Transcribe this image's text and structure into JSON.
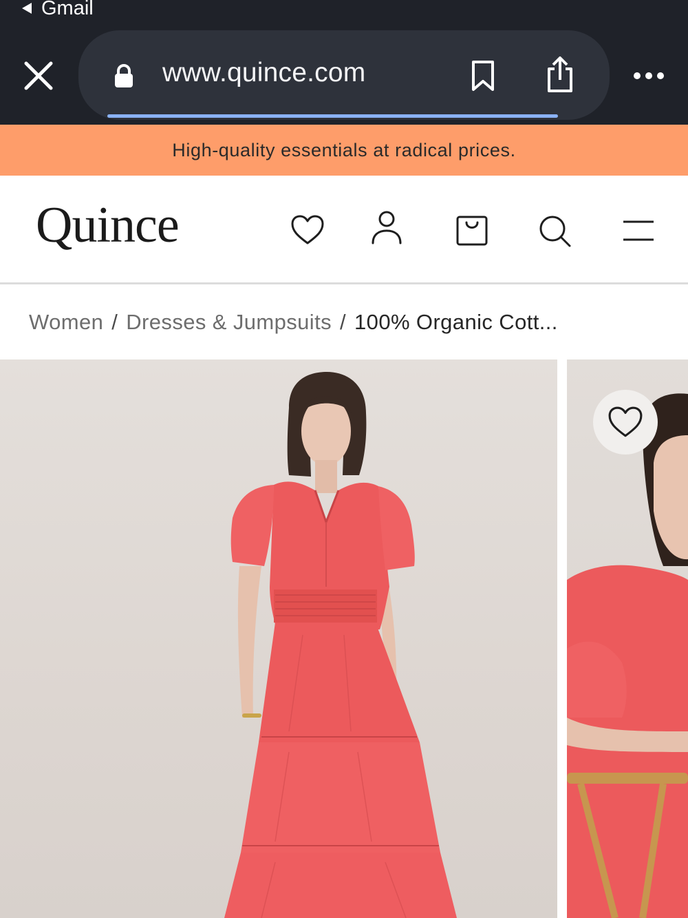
{
  "status_bar": {
    "back_app_label": "Gmail"
  },
  "browser": {
    "url": "www.quince.com",
    "icons": [
      "close-icon",
      "lock-icon",
      "bookmark-icon",
      "share-icon",
      "more-icon"
    ],
    "load_progress": 0.85
  },
  "promo_banner": {
    "text": "High-quality essentials at radical prices."
  },
  "header": {
    "logo": "Quince",
    "icons": [
      "heart-icon",
      "user-icon",
      "bag-icon",
      "search-icon",
      "menu-icon"
    ]
  },
  "breadcrumb": {
    "items": [
      "Women",
      "Dresses & Jumpsuits",
      "100% Organic Cott..."
    ],
    "separator": "/"
  },
  "gallery": {
    "icons": [
      "heart-icon"
    ]
  },
  "colors": {
    "chrome_bg": "#1f2229",
    "url_pill_bg": "#2e323b",
    "progress": "#8ab2f5",
    "promo_bg": "#fe9d6a",
    "dress": "#ec5a5c"
  }
}
